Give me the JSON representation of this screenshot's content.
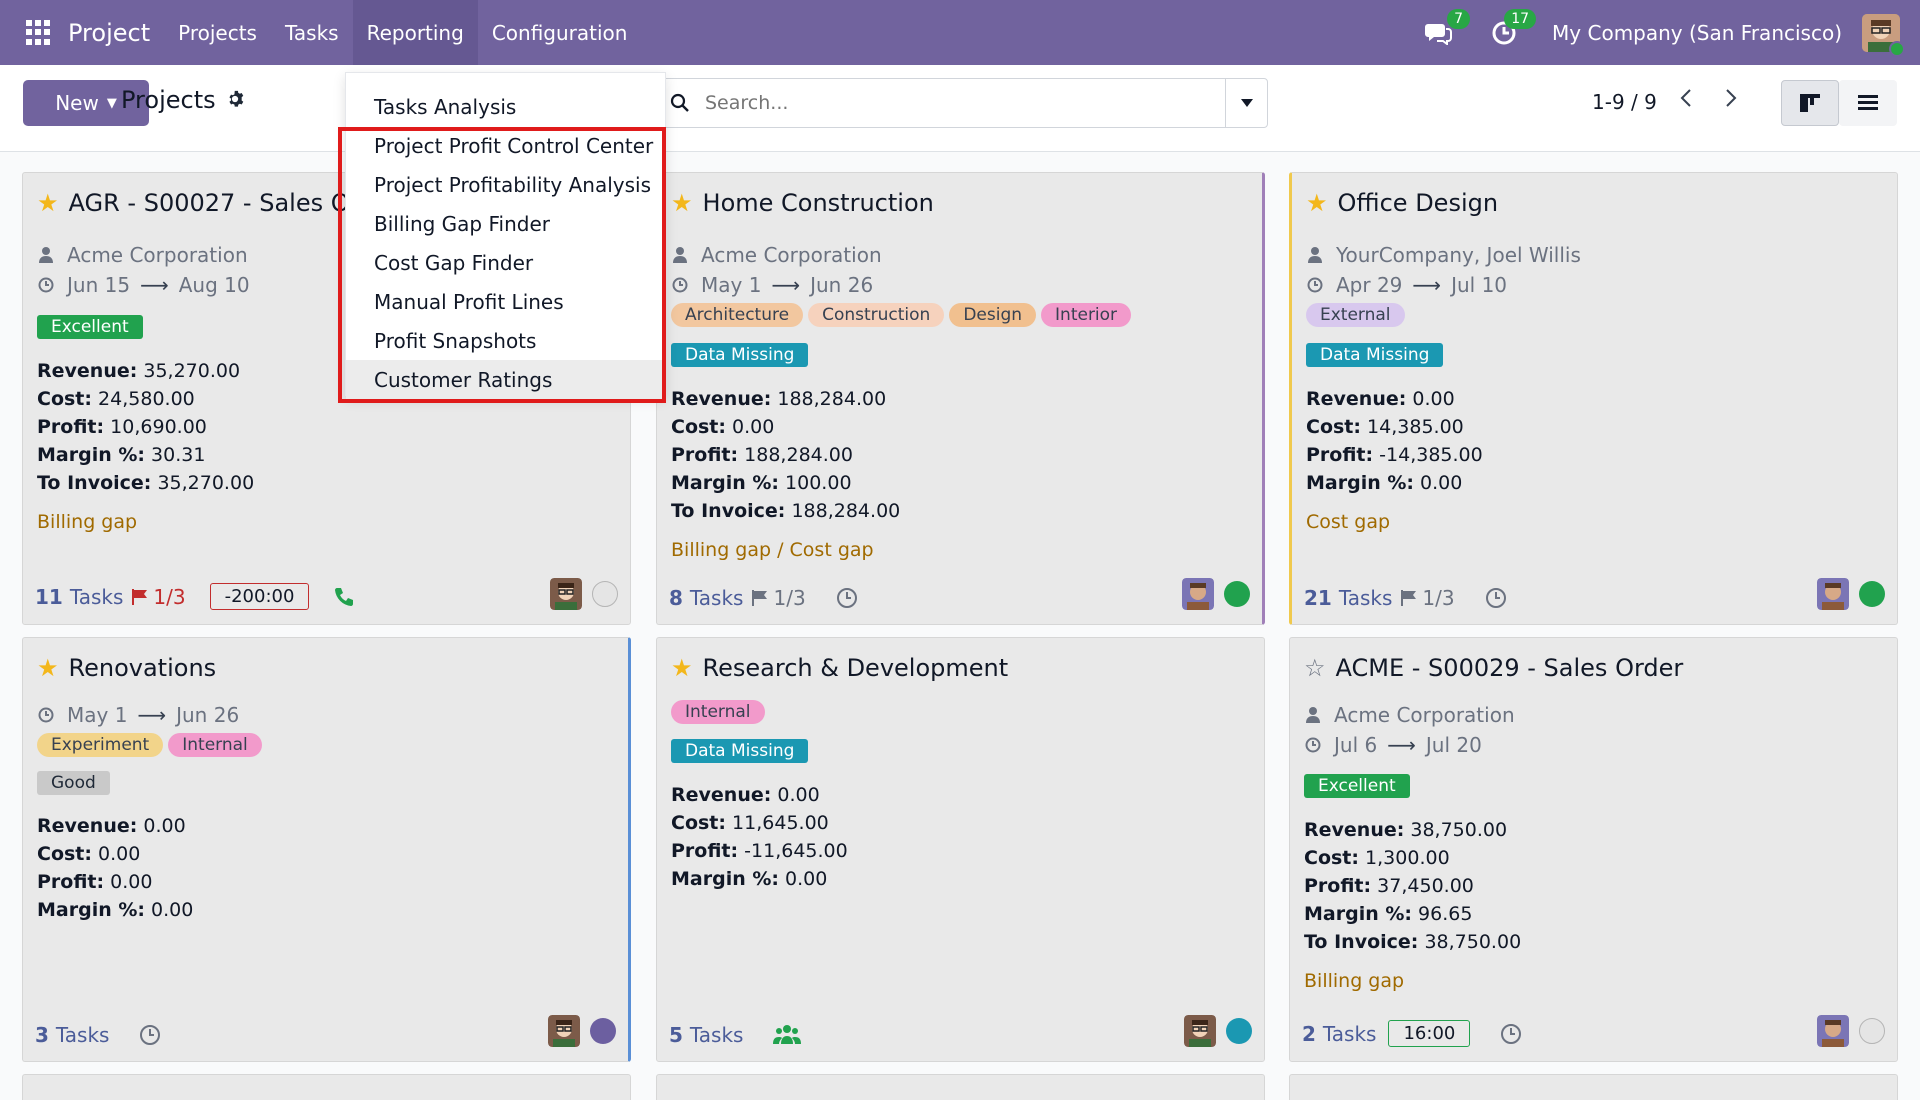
{
  "topbar": {
    "app_name": "Project",
    "menu": [
      "Projects",
      "Tasks",
      "Reporting",
      "Configuration"
    ],
    "messages_count": "7",
    "activities_count": "17",
    "company": "My Company (San Francisco)"
  },
  "control": {
    "new_label": "New",
    "breadcrumb": "Projects",
    "search_placeholder": "Search...",
    "pager": "1-9 / 9"
  },
  "reporting_menu": [
    "Tasks Analysis",
    "Project Profit Control Center",
    "Project Profitability Analysis",
    "Billing Gap Finder",
    "Cost Gap Finder",
    "Manual Profit Lines",
    "Profit Snapshots",
    "Customer Ratings"
  ],
  "cards": [
    {
      "title": "AGR - S00027 - Sales Or",
      "customer": "Acme Corporation",
      "date_start": "Jun 15",
      "date_end": "Aug 10",
      "status_label": "Excellent",
      "revenue": "35,270.00",
      "cost": "24,580.00",
      "profit": "10,690.00",
      "margin": "30.31",
      "to_invoice": "35,270.00",
      "gap": "Billing gap",
      "tasks_count": "11",
      "tasks_word": "Tasks",
      "milestones": "1/3",
      "timer": "-200:00"
    },
    {
      "title": "Home Construction",
      "customer": "Acme Corporation",
      "date_start": "May 1",
      "date_end": "Jun 26",
      "tags": [
        "Architecture",
        "Construction",
        "Design",
        "Interior"
      ],
      "status_label": "Data Missing",
      "revenue": "188,284.00",
      "cost": "0.00",
      "profit": "188,284.00",
      "margin": "100.00",
      "to_invoice": "188,284.00",
      "gap": "Billing gap / Cost gap",
      "tasks_count": "8",
      "tasks_word": "Tasks",
      "milestones": "1/3"
    },
    {
      "title": "Office Design",
      "customer": "YourCompany, Joel Willis",
      "date_start": "Apr 29",
      "date_end": "Jul 10",
      "tags": [
        "External"
      ],
      "status_label": "Data Missing",
      "revenue": "0.00",
      "cost": "14,385.00",
      "profit": "-14,385.00",
      "margin": "0.00",
      "gap": "Cost gap",
      "tasks_count": "21",
      "tasks_word": "Tasks",
      "milestones": "1/3"
    },
    {
      "title": "Renovations",
      "date_start": "May 1",
      "date_end": "Jun 26",
      "tags": [
        "Experiment",
        "Internal"
      ],
      "status_label": "Good",
      "revenue": "0.00",
      "cost": "0.00",
      "profit": "0.00",
      "margin": "0.00",
      "tasks_count": "3",
      "tasks_word": "Tasks"
    },
    {
      "title": "Research & Development",
      "tags": [
        "Internal"
      ],
      "status_label": "Data Missing",
      "revenue": "0.00",
      "cost": "11,645.00",
      "profit": "-11,645.00",
      "margin": "0.00",
      "tasks_count": "5",
      "tasks_word": "Tasks"
    },
    {
      "title": "ACME - S00029 - Sales Order",
      "customer": "Acme Corporation",
      "date_start": "Jul 6",
      "date_end": "Jul 20",
      "status_label": "Excellent",
      "revenue": "38,750.00",
      "cost": "1,300.00",
      "profit": "37,450.00",
      "margin": "96.65",
      "to_invoice": "38,750.00",
      "gap": "Billing gap",
      "tasks_count": "2",
      "tasks_word": "Tasks",
      "timer": "16:00"
    }
  ],
  "labels": {
    "revenue": "Revenue:",
    "cost": "Cost:",
    "profit": "Profit:",
    "margin": "Margin %:",
    "to_invoice": "To Invoice:"
  },
  "colors": {
    "navbar": "#71639e",
    "accent": "#71639e",
    "highlight_border": "#e01b1b"
  }
}
